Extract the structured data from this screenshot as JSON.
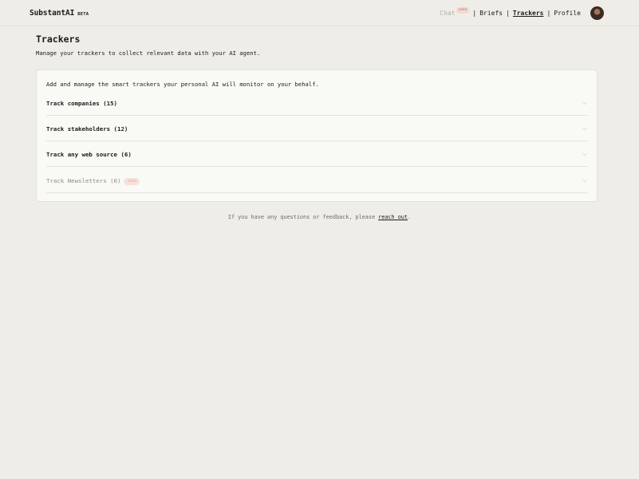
{
  "header": {
    "brand": "SubstantAI",
    "beta": "BETA",
    "nav": {
      "chat": "Chat",
      "chat_badge": "soon",
      "briefs": "Briefs",
      "trackers": "Trackers",
      "profile": "Profile",
      "separator": "|"
    }
  },
  "page": {
    "title": "Trackers",
    "subtitle": "Manage your trackers to collect relevant data with your AI agent."
  },
  "card": {
    "intro": "Add and manage the smart trackers your personal AI will monitor on your behalf.",
    "rows": [
      {
        "label": "Track companies (15)"
      },
      {
        "label": "Track stakeholders (12)"
      },
      {
        "label": "Track any web source (6)"
      },
      {
        "label": "Track Newsletters (0)",
        "badge": "soon"
      }
    ]
  },
  "footer": {
    "text": "If you have any questions or feedback, please ",
    "link": "reach out",
    "end": "."
  },
  "icons": {
    "row_chevron": "chevron-down-icon",
    "avatar": "user-avatar"
  },
  "colors": {
    "background": "#efede8",
    "card": "#f9f9f6",
    "badge_bg": "#f3d8cd",
    "muted_text": "#8f8a83"
  }
}
